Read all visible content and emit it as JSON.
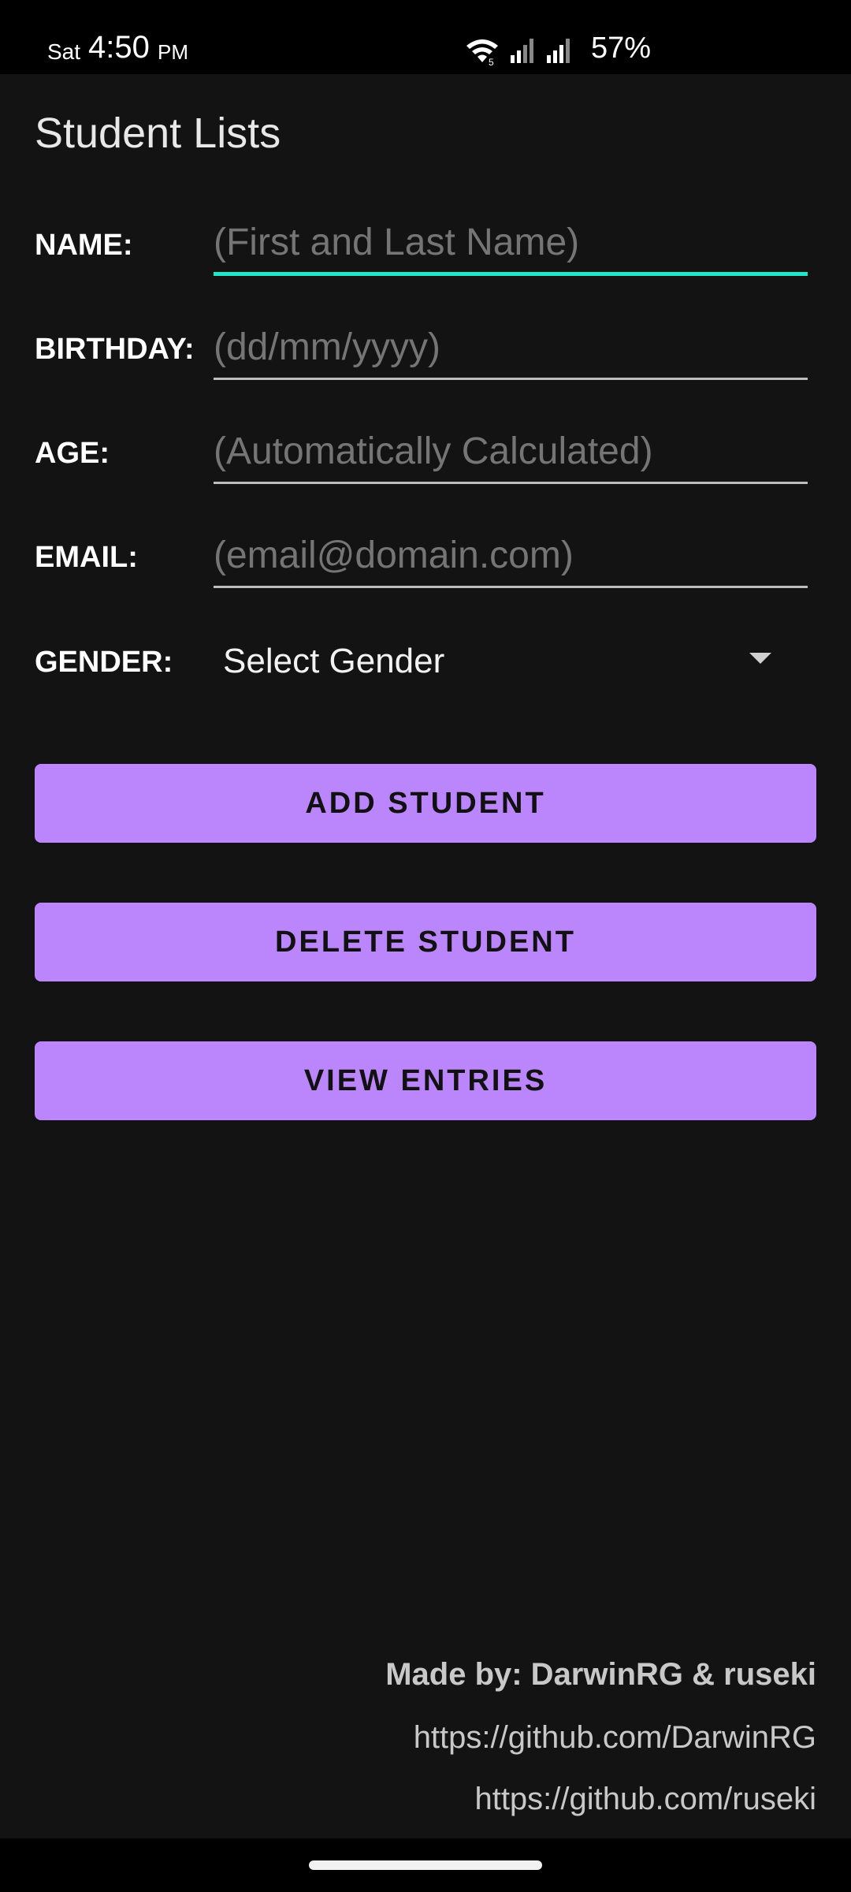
{
  "status_bar": {
    "day": "Sat",
    "time": "4:50",
    "ampm": "PM",
    "battery": "57%",
    "icons": [
      "wifi-icon",
      "cell-signal-icon",
      "cell-signal-icon"
    ]
  },
  "app": {
    "title": "Student Lists",
    "form": {
      "name": {
        "label": "NAME:",
        "value": "",
        "placeholder": "(First and Last Name)"
      },
      "birthday": {
        "label": "BIRTHDAY:",
        "value": "",
        "placeholder": "(dd/mm/yyyy)"
      },
      "age": {
        "label": "AGE:",
        "value": "",
        "placeholder": "(Automatically Calculated)"
      },
      "email": {
        "label": "EMAIL:",
        "value": "",
        "placeholder": "(email@domain.com)"
      },
      "gender": {
        "label": "GENDER:",
        "selected": "Select Gender"
      }
    },
    "buttons": {
      "add": "ADD STUDENT",
      "delete": "DELETE STUDENT",
      "view": "VIEW ENTRIES"
    },
    "credits": {
      "made_by": "Made by: DarwinRG & ruseki",
      "link1": "https://github.com/DarwinRG",
      "link2": "https://github.com/ruseki"
    }
  },
  "colors": {
    "accent_button": "#bb86fc",
    "focus_underline": "#1de9c6",
    "background": "#131313"
  }
}
